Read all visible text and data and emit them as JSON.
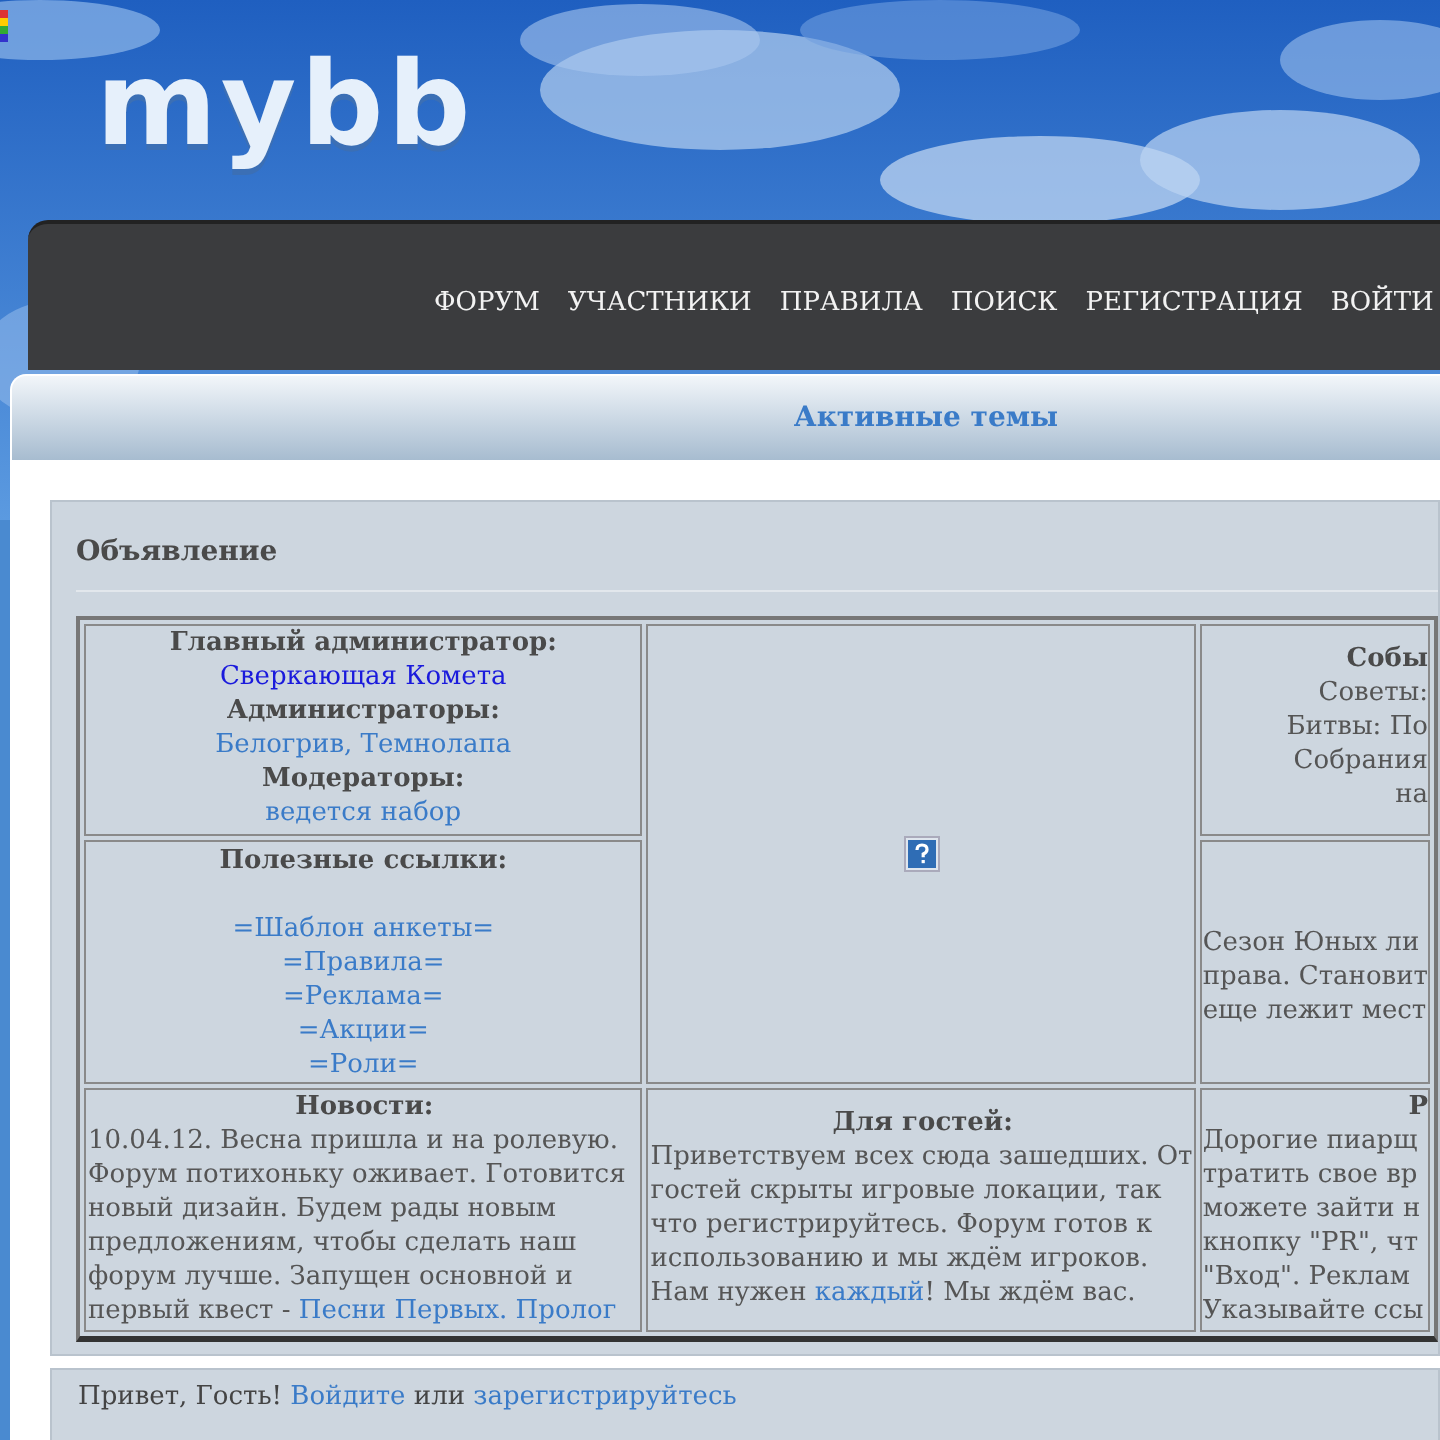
{
  "logo": {
    "text": "mybb"
  },
  "nav": [
    {
      "label": "ФОРУМ"
    },
    {
      "label": "УЧАСТНИКИ"
    },
    {
      "label": "ПРАВИЛА"
    },
    {
      "label": "ПОИСК"
    },
    {
      "label": "РЕГИСТРАЦИЯ"
    },
    {
      "label": "ВОЙТИ"
    }
  ],
  "active_topics_bar": {
    "label": "Активные темы"
  },
  "announcement": {
    "title": "Объявление",
    "admins_cell": {
      "lines": [
        {
          "kind": "heading",
          "text": "Главный администратор:"
        },
        {
          "kind": "user",
          "text": "Сверкающая Комета"
        },
        {
          "kind": "heading",
          "text": "Администраторы:"
        },
        {
          "kind": "link",
          "text": "Белогрив, Темнолапа"
        },
        {
          "kind": "heading",
          "text": "Модераторы:"
        },
        {
          "kind": "link",
          "text": "ведется набор"
        }
      ]
    },
    "links_cell": {
      "spaced": true,
      "lines": [
        {
          "kind": "heading",
          "text": "Полезные ссылки:"
        },
        {
          "kind": "link",
          "text": "=Шаблон анкеты="
        },
        {
          "kind": "link",
          "text": "=Правила="
        },
        {
          "kind": "link",
          "text": "=Реклама="
        },
        {
          "kind": "link",
          "text": "=Акции="
        },
        {
          "kind": "link",
          "text": "=Роли="
        }
      ]
    },
    "image_cell": {
      "kind": "broken-image"
    },
    "news_cell": {
      "heading": "Новости:",
      "segments": [
        {
          "text": "10.04.12. Весна пришла и на ролевую. Форум потихоньку оживает. Готовится новый дизайн. Будем рады новым предложениям, чтобы сделать наш форум лучше. Запущен основной и первый квест - ",
          "link": false
        },
        {
          "text": "Песни Первых. Пролог",
          "link": true
        }
      ]
    },
    "guests_cell": {
      "heading": "Для гостей:",
      "segments": [
        {
          "text": "Приветствуем всех сюда зашедших. От гостей скрыты игровые локации, так что регистрируйтесь. Форум готов к использованию и мы ждём игроков. Нам нужен ",
          "link": false
        },
        {
          "text": "каждый",
          "link": true
        },
        {
          "text": "! Мы ждём вас.",
          "link": false
        }
      ]
    },
    "right_cells": [
      {
        "lines": [
          {
            "kind": "heading",
            "right_aligned": true,
            "text": "Собы"
          },
          {
            "kind": "text",
            "right_aligned": true,
            "text": "Советы:"
          },
          {
            "kind": "text",
            "right_aligned": true,
            "text": "Битвы: По"
          },
          {
            "kind": "text",
            "right_aligned": true,
            "text": "Собрания"
          },
          {
            "kind": "text",
            "right_aligned": true,
            "text": "на"
          }
        ]
      },
      {
        "lines": [
          {
            "kind": "text",
            "right_aligned": false,
            "text": "Сезон Юных ли"
          },
          {
            "kind": "text",
            "right_aligned": false,
            "text": "права. Становит"
          },
          {
            "kind": "text",
            "right_aligned": false,
            "text": "еще лежит мест"
          }
        ]
      },
      {
        "lines": [
          {
            "kind": "heading",
            "right_aligned": true,
            "text": "Р"
          },
          {
            "kind": "text",
            "right_aligned": false,
            "text": "Дорогие пиарщ"
          },
          {
            "kind": "text",
            "right_aligned": false,
            "text": "тратить свое вр"
          },
          {
            "kind": "text",
            "right_aligned": false,
            "text": "можете зайти н"
          },
          {
            "kind": "text",
            "right_aligned": false,
            "text": "кнопку \"PR\", чт"
          },
          {
            "kind": "text",
            "right_aligned": false,
            "text": "\"Вход\". Реклам"
          },
          {
            "kind": "text",
            "right_aligned": false,
            "text": "Указывайте ссы"
          }
        ]
      }
    ]
  },
  "greeting": {
    "segments": [
      {
        "text": "Привет, Гость!",
        "link": false
      },
      {
        "text": "Войдите",
        "link": true
      },
      {
        "text": "или",
        "link": false
      },
      {
        "text": "зарегистрируйтесь",
        "link": true
      }
    ]
  }
}
